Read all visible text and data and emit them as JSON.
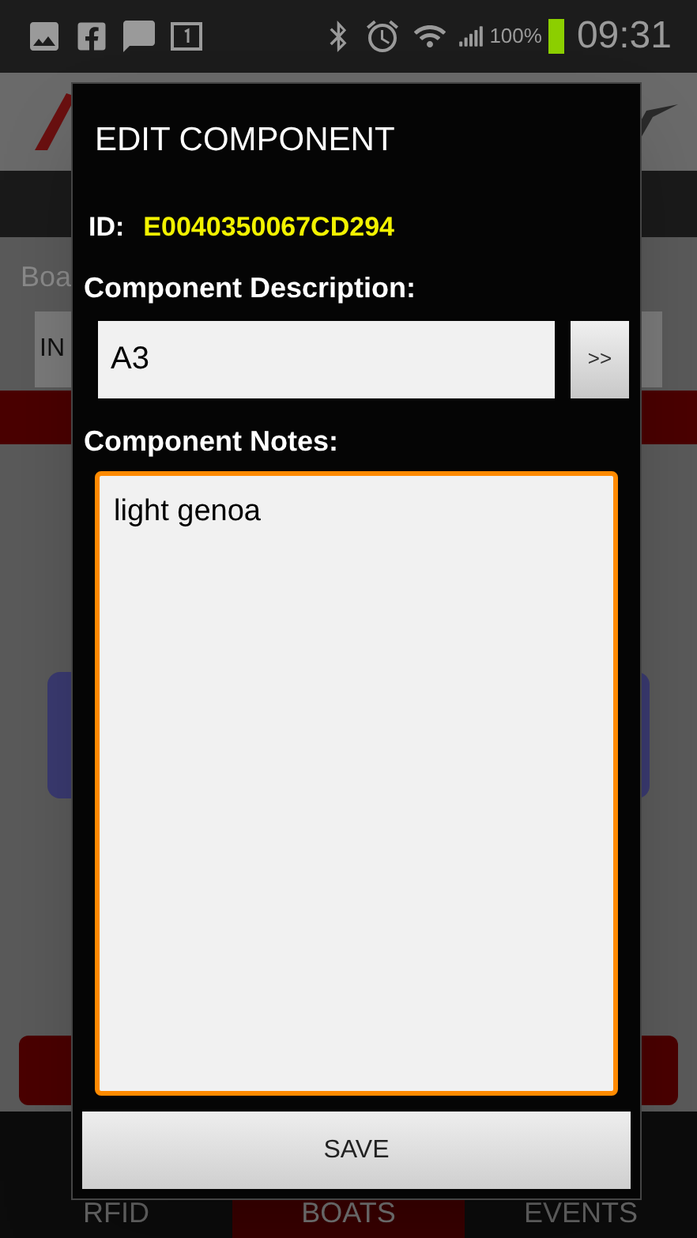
{
  "status_bar": {
    "battery": "100%",
    "time": "09:31"
  },
  "background": {
    "field_label": "Boa",
    "field_value": "IN",
    "tabs": [
      {
        "label": "RFID",
        "selected": false
      },
      {
        "label": "BOATS",
        "selected": true
      },
      {
        "label": "EVENTS",
        "selected": false
      }
    ]
  },
  "dialog": {
    "title": "EDIT COMPONENT",
    "id_label": "ID:",
    "id_value": "E0040350067CD294",
    "description_label": "Component Description:",
    "description_value": "A3",
    "more_button": ">>",
    "notes_label": "Component Notes:",
    "notes_value": "light genoa",
    "notes_focused": true,
    "save_button": "SAVE"
  }
}
